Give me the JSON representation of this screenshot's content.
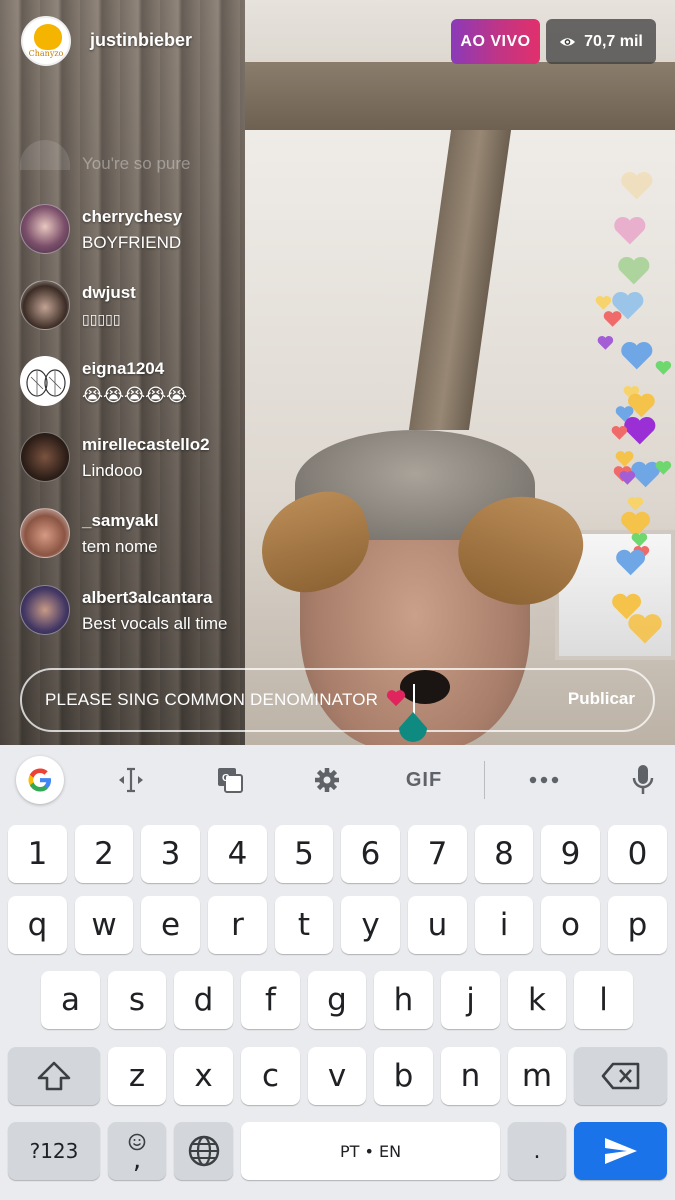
{
  "header": {
    "host_username": "justinbieber",
    "avatar_logo_text": "Chanyzo",
    "live_badge": "AO VIVO",
    "viewer_count": "70,7 mil"
  },
  "comments": [
    {
      "username": "",
      "text": "You're so pure",
      "faded": true
    },
    {
      "username": "cherrychesy",
      "text": "BOYFRIEND"
    },
    {
      "username": "dwjust",
      "text": "▯▯▯▯▯"
    },
    {
      "username": "eigna1204",
      "text": "😭😭😭😭😭"
    },
    {
      "username": "mirellecastello2",
      "text": "Lindooo"
    },
    {
      "username": "_samyakl",
      "text": "tem nome"
    },
    {
      "username": "albert3alcantara",
      "text": "Best vocals all time"
    }
  ],
  "composer": {
    "input_value": "PLEASE SING COMMON DENOMINATOR",
    "publish_label": "Publicar"
  },
  "keyboard": {
    "toolbar": [
      "google-icon",
      "text-cursor-icon",
      "translate-icon",
      "gear-icon",
      "GIF",
      "more-icon",
      "microphone-icon"
    ],
    "toolbar_gif": "GIF",
    "row_numbers": [
      "1",
      "2",
      "3",
      "4",
      "5",
      "6",
      "7",
      "8",
      "9",
      "0"
    ],
    "row1": [
      "q",
      "w",
      "e",
      "r",
      "t",
      "y",
      "u",
      "i",
      "o",
      "p"
    ],
    "row2": [
      "a",
      "s",
      "d",
      "f",
      "g",
      "h",
      "j",
      "k",
      "l"
    ],
    "row3": [
      "z",
      "x",
      "c",
      "v",
      "b",
      "n",
      "m"
    ],
    "symbols_label": "?123",
    "comma_label": ",",
    "space_label": "PT • EN",
    "period_label": "."
  },
  "colors": {
    "live_gradient": [
      "#8a3ab9",
      "#c13584",
      "#e1306c"
    ],
    "send_key": "#1a73e8",
    "cursor_handle": "#0e8a80"
  }
}
